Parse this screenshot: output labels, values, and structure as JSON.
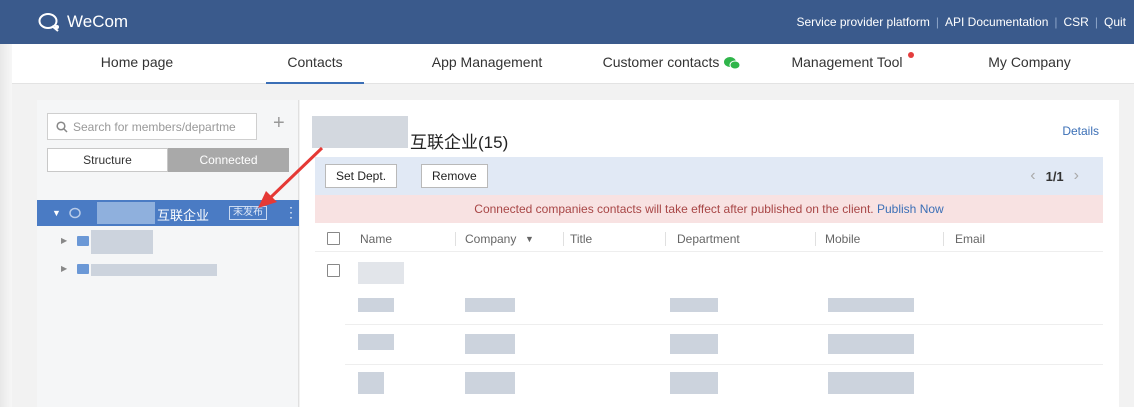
{
  "app": {
    "name": "WeCom"
  },
  "top_links": [
    "Service provider platform",
    "API Documentation",
    "CSR",
    "Quit"
  ],
  "nav": {
    "items": [
      {
        "label": "Home page"
      },
      {
        "label": "Contacts",
        "active": true
      },
      {
        "label": "App Management"
      },
      {
        "label": "Customer contacts"
      },
      {
        "label": "Management Tool",
        "has_dot": true
      },
      {
        "label": "My Company"
      }
    ]
  },
  "left": {
    "search_placeholder": "Search for members/departme",
    "plus": "+",
    "tabs": [
      "Structure",
      "Connected"
    ],
    "active_tab": "Connected",
    "selected_node": {
      "name_suffix": "互联企业",
      "badge": "未发布",
      "more": "⋮"
    }
  },
  "right": {
    "title_suffix": "互联企业(15)",
    "details": "Details",
    "buttons": {
      "set_dept": "Set Dept.",
      "remove": "Remove"
    },
    "pager": {
      "text": "1/1",
      "prev": "‹",
      "next": "›"
    },
    "notice": {
      "text": "Connected companies contacts will take effect after published on the client.",
      "link": "Publish Now"
    },
    "columns": [
      "Name",
      "Company",
      "Title",
      "Department",
      "Mobile",
      "Email"
    ],
    "company_sort": "▼"
  },
  "colors": {
    "brand": "#3a5a8c",
    "accent": "#4a7bc4",
    "notice_bg": "#f8e2e2",
    "annotation_arrow": "#e53935"
  }
}
